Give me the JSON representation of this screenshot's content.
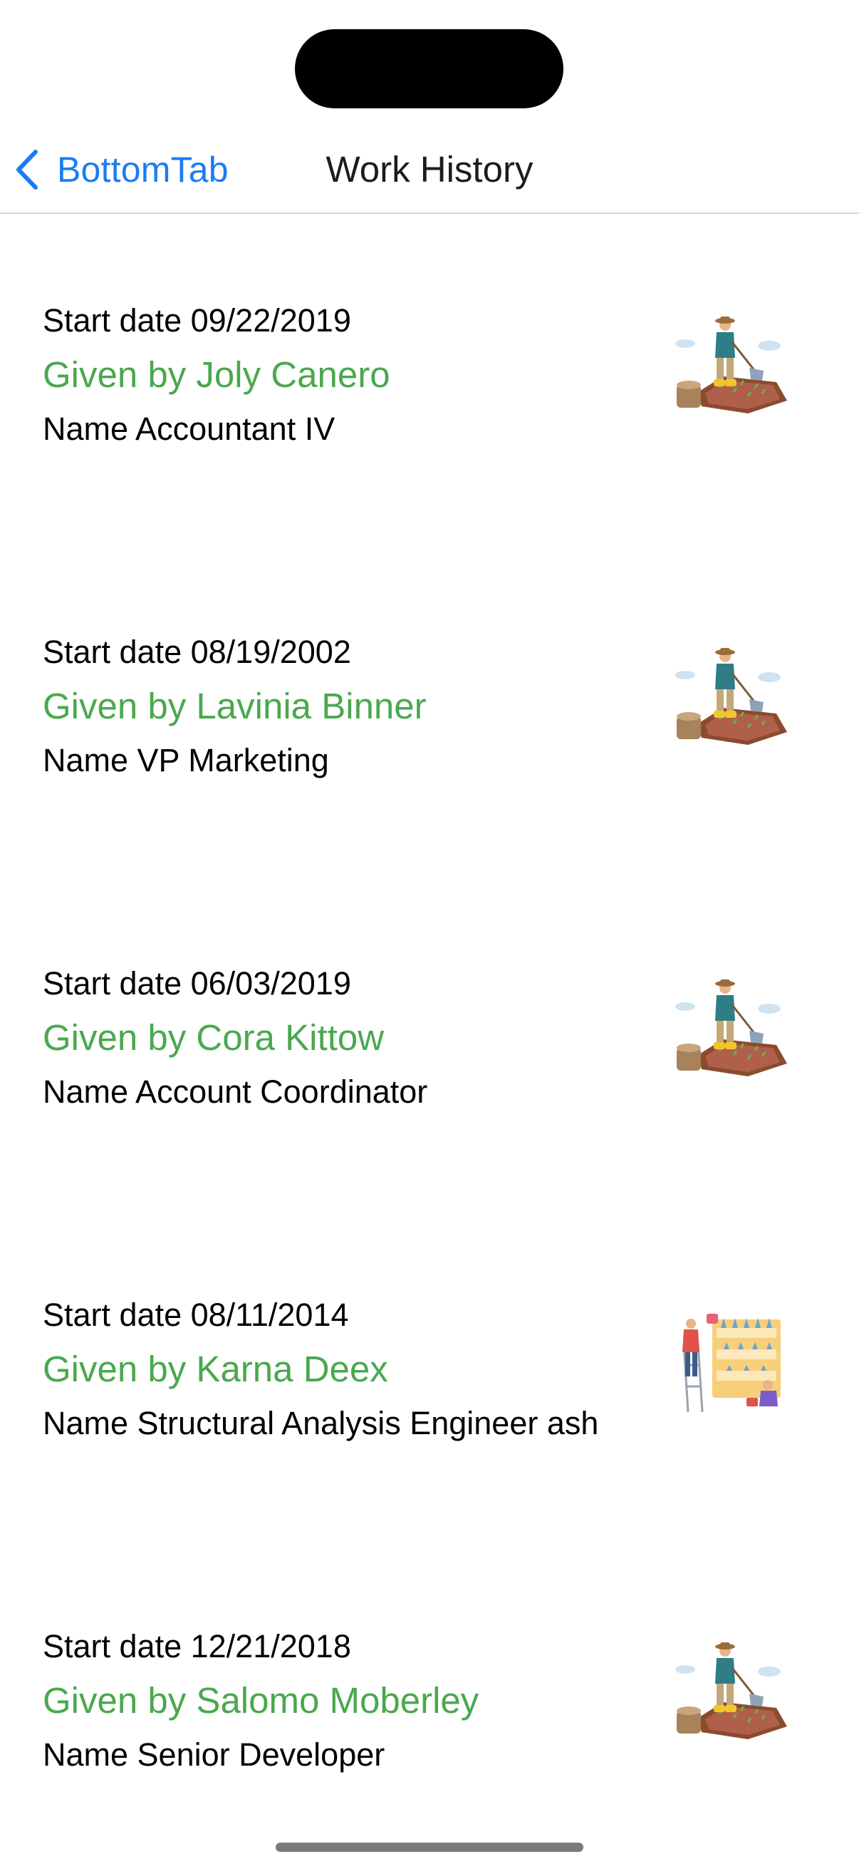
{
  "nav": {
    "back_label": "BottomTab",
    "title": "Work History"
  },
  "colors": {
    "accent": "#1a7cf5",
    "given_green": "#4aa84e"
  },
  "items": [
    {
      "start": "Start date 09/22/2019",
      "given": "Given by Joly Canero",
      "name": "Name Accountant IV",
      "image": "farmer-hoeing-illustration"
    },
    {
      "start": "Start date 08/19/2002",
      "given": "Given by Lavinia Binner",
      "name": "Name VP Marketing",
      "image": "farmer-hoeing-illustration"
    },
    {
      "start": "Start date 06/03/2019",
      "given": "Given by Cora Kittow",
      "name": "Name Account Coordinator",
      "image": "farmer-hoeing-illustration"
    },
    {
      "start": "Start date 08/11/2014",
      "given": "Given by Karna Deex",
      "name": "Name Structural Analysis Engineer ash",
      "image": "vertical-farming-illustration"
    },
    {
      "start": "Start date 12/21/2018",
      "given": "Given by Salomo Moberley",
      "name": "Name Senior Developer",
      "image": "farmer-hoeing-illustration"
    }
  ]
}
